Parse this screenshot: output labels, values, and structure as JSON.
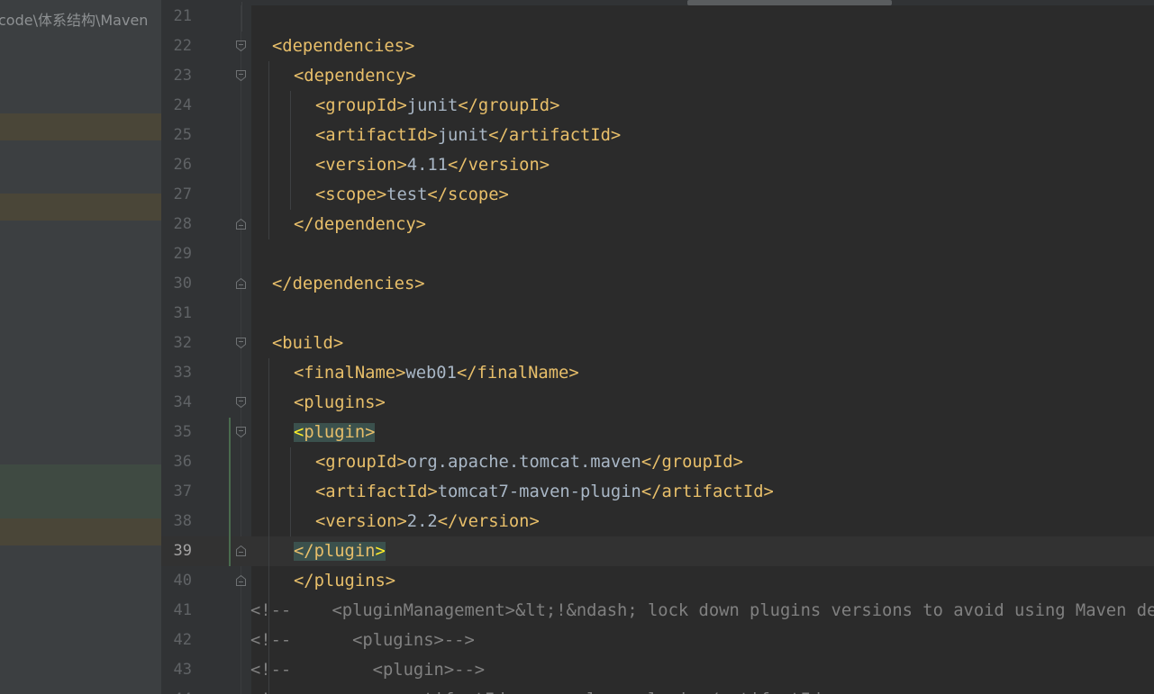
{
  "project_panel": {
    "path_text": "code\\体系结构\\Maven"
  },
  "editor": {
    "current_line": "39",
    "lines": [
      {
        "num": "21",
        "parts": []
      },
      {
        "num": "22",
        "parts": [
          {
            "t": "<dependencies>",
            "c": "tag"
          }
        ],
        "indent": 2,
        "fold": "open"
      },
      {
        "num": "23",
        "parts": [
          {
            "t": "<dependency>",
            "c": "tag"
          }
        ],
        "indent": 4,
        "fold": "open"
      },
      {
        "num": "24",
        "parts": [
          {
            "t": "<groupId>",
            "c": "tag"
          },
          {
            "t": "junit",
            "c": "txt"
          },
          {
            "t": "</groupId>",
            "c": "tag"
          }
        ],
        "indent": 6
      },
      {
        "num": "25",
        "parts": [
          {
            "t": "<artifactId>",
            "c": "tag"
          },
          {
            "t": "junit",
            "c": "txt"
          },
          {
            "t": "</artifactId>",
            "c": "tag"
          }
        ],
        "indent": 6
      },
      {
        "num": "26",
        "parts": [
          {
            "t": "<version>",
            "c": "tag"
          },
          {
            "t": "4.11",
            "c": "txt"
          },
          {
            "t": "</version>",
            "c": "tag"
          }
        ],
        "indent": 6
      },
      {
        "num": "27",
        "parts": [
          {
            "t": "<scope>",
            "c": "tag"
          },
          {
            "t": "test",
            "c": "txt"
          },
          {
            "t": "</scope>",
            "c": "tag"
          }
        ],
        "indent": 6
      },
      {
        "num": "28",
        "parts": [
          {
            "t": "</dependency>",
            "c": "tag"
          }
        ],
        "indent": 4,
        "fold": "close"
      },
      {
        "num": "29",
        "parts": []
      },
      {
        "num": "30",
        "parts": [
          {
            "t": "</dependencies>",
            "c": "tag"
          }
        ],
        "indent": 2,
        "fold": "close"
      },
      {
        "num": "31",
        "parts": []
      },
      {
        "num": "32",
        "parts": [
          {
            "t": "<build>",
            "c": "tag"
          }
        ],
        "indent": 2,
        "fold": "open"
      },
      {
        "num": "33",
        "parts": [
          {
            "t": "<finalName>",
            "c": "tag"
          },
          {
            "t": "web01",
            "c": "txt"
          },
          {
            "t": "</finalName>",
            "c": "tag"
          }
        ],
        "indent": 4
      },
      {
        "num": "34",
        "parts": [
          {
            "t": "<plugins>",
            "c": "tag"
          }
        ],
        "indent": 4,
        "fold": "open"
      },
      {
        "num": "35",
        "parts": [
          {
            "t": "<plugin>",
            "c": "tag",
            "match": true
          }
        ],
        "indent": 4,
        "fold": "open"
      },
      {
        "num": "36",
        "parts": [
          {
            "t": "<groupId>",
            "c": "tag"
          },
          {
            "t": "org.apache.tomcat.maven",
            "c": "txt"
          },
          {
            "t": "</groupId>",
            "c": "tag"
          }
        ],
        "indent": 6
      },
      {
        "num": "37",
        "parts": [
          {
            "t": "<artifactId>",
            "c": "tag"
          },
          {
            "t": "tomcat7-maven-plugin",
            "c": "txt"
          },
          {
            "t": "</artifactId>",
            "c": "tag"
          }
        ],
        "indent": 6
      },
      {
        "num": "38",
        "parts": [
          {
            "t": "<version>",
            "c": "tag"
          },
          {
            "t": "2.2",
            "c": "txt"
          },
          {
            "t": "</version>",
            "c": "tag"
          }
        ],
        "indent": 6
      },
      {
        "num": "39",
        "parts": [
          {
            "t": "</plugin>",
            "c": "tag",
            "match": true
          }
        ],
        "indent": 4,
        "fold": "close"
      },
      {
        "num": "40",
        "parts": [
          {
            "t": "</plugins>",
            "c": "tag"
          }
        ],
        "indent": 4,
        "fold": "close"
      },
      {
        "num": "41",
        "parts": [
          {
            "t": "<!--    <pluginManagement>&lt;!&ndash; lock down plugins versions to avoid using Maven defaults (may be moved to parent pom) &ndash;&gt;-->",
            "c": "cmt"
          }
        ],
        "indent": 0
      },
      {
        "num": "42",
        "parts": [
          {
            "t": "<!--      <plugins>-->",
            "c": "cmt"
          }
        ],
        "indent": 0
      },
      {
        "num": "43",
        "parts": [
          {
            "t": "<!--        <plugin>-->",
            "c": "cmt"
          }
        ],
        "indent": 0
      },
      {
        "num": "44",
        "parts": [
          {
            "t": "<!--          <artifactId>maven-clean-plugin</artifactId>-->",
            "c": "cmt"
          }
        ],
        "indent": 0
      }
    ]
  },
  "colors": {
    "tag": "#e8bf6a",
    "text": "#a9b7c6",
    "comment": "#808080",
    "background": "#2b2b2b",
    "gutter": "#313335"
  }
}
